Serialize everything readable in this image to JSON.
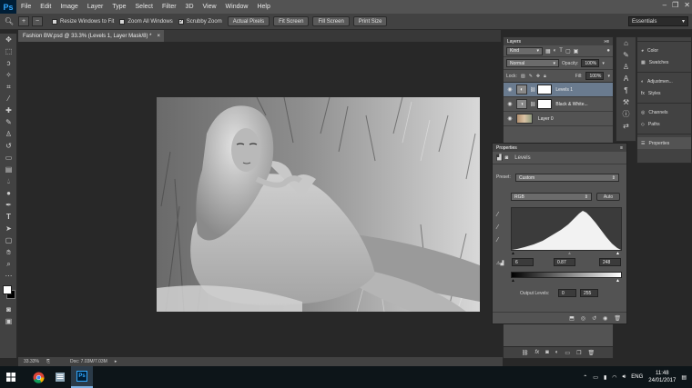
{
  "menubar": {
    "logo": "Ps",
    "items": [
      "File",
      "Edit",
      "Image",
      "Layer",
      "Type",
      "Select",
      "Filter",
      "3D",
      "View",
      "Window",
      "Help"
    ]
  },
  "options_bar": {
    "resize_windows_label": "Resize Windows to Fit",
    "zoom_all_label": "Zoom All Windows",
    "scrubby_zoom_label": "Scrubby Zoom",
    "actual_pixels_label": "Actual Pixels",
    "fit_screen_label": "Fit Screen",
    "fill_screen_label": "Fill Screen",
    "print_size_label": "Print Size",
    "workspace": "Essentials"
  },
  "document": {
    "tab_title": "Fashion BW.psd @ 33.3% (Levels 1, Layer Mask/8) *",
    "zoom": "33.33%",
    "doc_size": "Doc: 7.03M/7.03M"
  },
  "layers_panel": {
    "title": "Layers",
    "kind": "Kind",
    "blend_mode": "Normal",
    "opacity_label": "Opacity:",
    "opacity": "100%",
    "lock_label": "Lock:",
    "fill_label": "Fill:",
    "fill": "100%",
    "layers": [
      {
        "name": "Levels 1",
        "selected": true
      },
      {
        "name": "Black & White...",
        "selected": false
      },
      {
        "name": "Layer 0",
        "selected": false
      }
    ]
  },
  "dock": {
    "items": [
      "Color",
      "Swatches",
      "Adjustmen...",
      "Styles",
      "Channels",
      "Paths",
      "Properties"
    ]
  },
  "properties": {
    "title": "Properties",
    "adjustment": "Levels",
    "preset_label": "Preset:",
    "preset": "Custom",
    "channel": "RGB",
    "auto_label": "Auto",
    "input_black": "6",
    "input_gamma": "0.87",
    "input_white": "248",
    "output_label": "Output Levels:",
    "output_black": "0",
    "output_white": "255"
  },
  "taskbar": {
    "lang": "ENG",
    "time": "11:48",
    "date": "24/01/2017"
  }
}
